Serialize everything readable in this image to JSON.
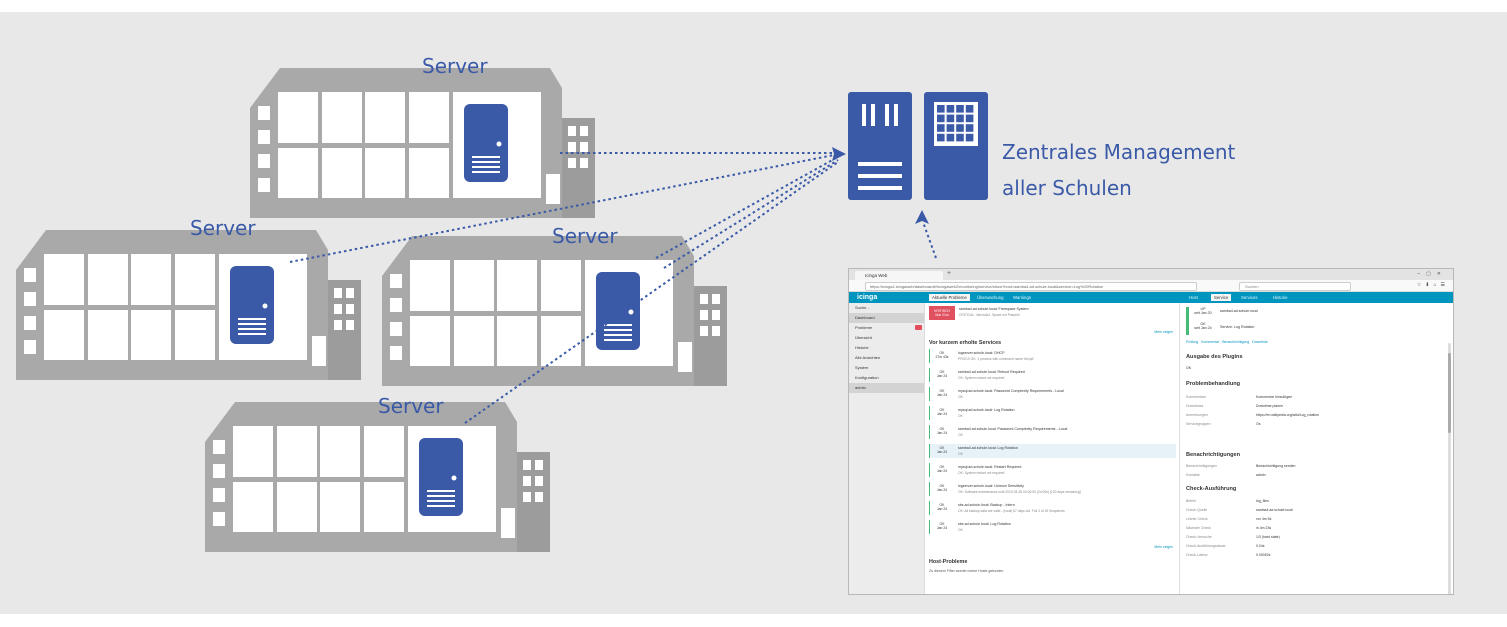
{
  "diagram": {
    "server_label": "Server",
    "management": {
      "line1": "Zentrales Management",
      "line2": "aller Schulen"
    },
    "colors": {
      "building": "#a9a9a9",
      "server_blue": "#3a5aa8",
      "dotted_line": "#3a5aa8",
      "background": "#e8e8e8"
    }
  },
  "screenshot": {
    "tab_title": "Icinga Web",
    "url": "https://icinga2.icingaweb/dashboard#!/icingaweb2/monitoring/service/show?host=samba4.ad.schule.local&service=Log%20Rotation",
    "search_placeholder": "Suchen",
    "logo": "icinga",
    "header_tabs": [
      "Aktuelle Probleme",
      "Überwachung",
      "Warnings",
      "Host",
      "Service",
      "Services",
      "Historie"
    ],
    "sidebar": {
      "search": "Suche...",
      "items": [
        "Dashboard",
        "Probleme",
        "Übersicht",
        "Historie",
        "Alle Ansichten",
        "System",
        "Konfiguration",
        "admin"
      ]
    },
    "critical": {
      "state": "KRITISCH",
      "since": "Mar 21st",
      "service": "samba4.ad.schule.local: Freespace System",
      "output": "CRITICAL: /dev/sda1: Space not Passed!"
    },
    "recent_title": "Vor kurzem erholte Services",
    "recent": [
      {
        "state": "OK",
        "since": "27m 43s",
        "service": "logserver.schule.local: DHCP",
        "output": "PROCS OK: 1 process with command name 'dhcpd'"
      },
      {
        "state": "OK",
        "since": "Jan 24",
        "service": "samba4.ad.schule.local: Reboot Required",
        "output": "OK: System restart not required"
      },
      {
        "state": "OK",
        "since": "Jan 24",
        "service": "mysql.ad.schule.local: Password Complexity Requirements - Local",
        "output": "OK"
      },
      {
        "state": "OK",
        "since": "Jan 24",
        "service": "mysql.ad.schule.local: Log Rotation",
        "output": "OK"
      },
      {
        "state": "OK",
        "since": "Jan 24",
        "service": "samba4.ad.schule.local: Password Complexity Requirements - Local",
        "output": "OK"
      },
      {
        "state": "OK",
        "since": "Jan 24",
        "service": "samba4.ad.schule.local: Log Rotation",
        "output": "OK"
      },
      {
        "state": "OK",
        "since": "Jan 24",
        "service": "mysql.ad.schule.local: Restart Required",
        "output": "OK: System restart not required"
      },
      {
        "state": "OK",
        "since": "Jan 24",
        "service": "logserver.schule.local: Unimon Sensitivity",
        "output": "OK: Software maintenance until 2019-03-28 00:00:00 (2d 00h) [100 days remaining]"
      },
      {
        "state": "OK",
        "since": "Jan 24",
        "service": "sbs.ad.schule.local: Backup - Intern",
        "output": "OK: All backup data are valid - (local) 87 days old, Full 3 of 15 Snapshots"
      },
      {
        "state": "OK",
        "since": "Jan 24",
        "service": "sbs.ad.schule.local: Log Rotation",
        "output": "OK"
      }
    ],
    "more_label": "Mehr zeigen",
    "host_problems_title": "Host-Probleme",
    "host_problems_text": "Zu diesem Filter wurden keine Hosts gefunden.",
    "detail": {
      "host_state": "UP",
      "host_since": "seit Jan 20",
      "host_name": "samba4.ad.schule.local",
      "svc_state": "OK",
      "svc_since": "seit Jan 24",
      "svc_name": "Service: Log Rotation",
      "actions": [
        "Prüfung",
        "Kommentar",
        "Benachrichtigung",
        "Downtime"
      ],
      "plugin_title": "Ausgabe des Plugins",
      "plugin_output": "OK",
      "problem_title": "Problembehandlung",
      "problem_rows": [
        {
          "k": "Kommentare",
          "v": "Kommentar hinzufügen"
        },
        {
          "k": "Downtimes",
          "v": "Downtime planen"
        },
        {
          "k": "Anmerkungen",
          "v": "https://en.wikipedia.org/wiki/Log_rotation"
        },
        {
          "k": "Servicegruppen",
          "v": "Os"
        }
      ],
      "notif_title": "Benachrichtigungen",
      "notif_rows": [
        {
          "k": "Benachrichtigungen",
          "v": "Benachrichtigung senden"
        },
        {
          "k": "Kontakte",
          "v": "admin"
        }
      ],
      "check_title": "Check-Ausführung",
      "check_rows": [
        {
          "k": "Befehl",
          "v": "log_files"
        },
        {
          "k": "Check-Quelle",
          "v": "samba4.ad.schule.local"
        },
        {
          "k": "Letzter Check",
          "v": "vor 4m 5s"
        },
        {
          "k": "Nächster Check",
          "v": "in 4m 23s"
        },
        {
          "k": "Check-Versuche",
          "v": "1/3 (hard state)"
        },
        {
          "k": "Check-Ausführungsdauer",
          "v": "0.04s"
        },
        {
          "k": "Check-Latenz",
          "v": "0.00052s"
        }
      ]
    }
  }
}
